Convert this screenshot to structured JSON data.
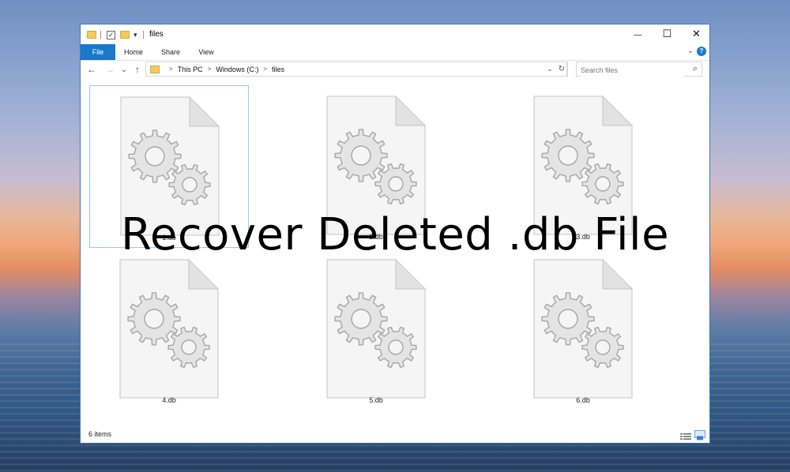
{
  "window": {
    "title": "files",
    "controls": {
      "minimize": "—",
      "maximize": "☐",
      "close": "✕"
    }
  },
  "ribbon": {
    "tabs": [
      "File",
      "Home",
      "Share",
      "View"
    ],
    "collapse": "⌄",
    "help": "?"
  },
  "nav": {
    "back": "←",
    "forward": "→",
    "recent": "⌄",
    "up": "↑",
    "breadcrumb": [
      "This PC",
      "Windows (C:)",
      "files"
    ],
    "breadcrumb_sep": ">",
    "dropdown": "⌄",
    "refresh": "↻",
    "search_placeholder": "Search files",
    "search_icon": "⌕"
  },
  "files": [
    {
      "name": "1.db",
      "icon": "system-file-gears-icon",
      "selected": true
    },
    {
      "name": "2.db",
      "icon": "system-file-gears-icon",
      "selected": false
    },
    {
      "name": "3.db",
      "icon": "system-file-gears-icon",
      "selected": false
    },
    {
      "name": "4.db",
      "icon": "system-file-gears-icon",
      "selected": false
    },
    {
      "name": "5.db",
      "icon": "system-file-gears-icon",
      "selected": false
    },
    {
      "name": "6.db",
      "icon": "system-file-gears-icon",
      "selected": false
    }
  ],
  "status": {
    "item_count": "6 items"
  },
  "overlay": {
    "title": "Recover Deleted .db File"
  },
  "colors": {
    "accent": "#1979ca",
    "selection_border": "#99c9f1",
    "folder": "#f4c95d"
  }
}
